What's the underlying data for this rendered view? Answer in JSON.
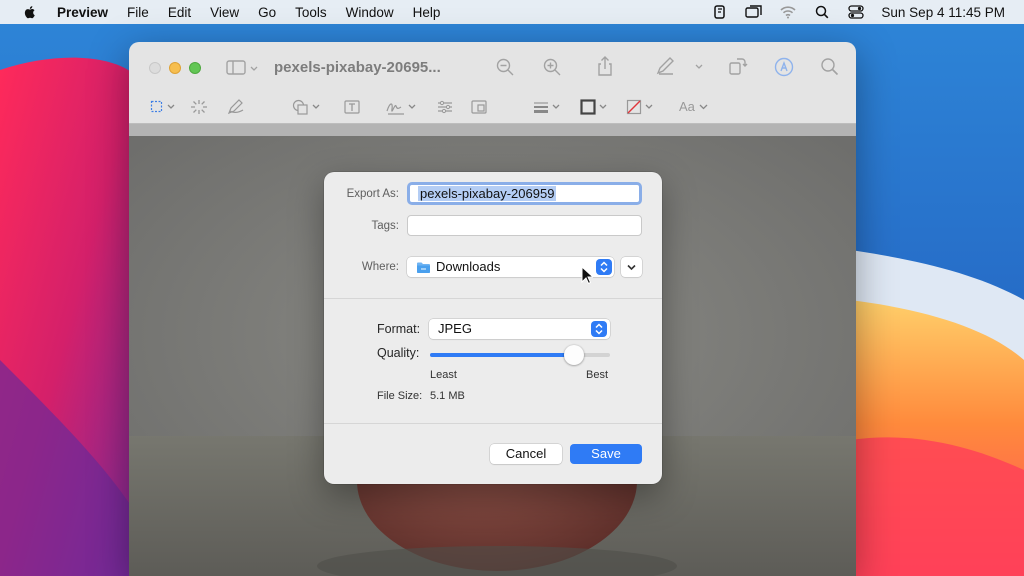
{
  "menubar": {
    "apple_icon": "apple-logo-icon",
    "app_name": "Preview",
    "items": [
      "File",
      "Edit",
      "View",
      "Go",
      "Tools",
      "Window",
      "Help"
    ],
    "status_icons": [
      "notes-icon",
      "screen-mirroring-icon",
      "wifi-icon",
      "search-icon",
      "control-center-icon"
    ],
    "clock": "Sun Sep 4  11:45 PM"
  },
  "window": {
    "title": "pexels-pixabay-20695...",
    "toolbar_icons": [
      "sidebar-icon",
      "zoom-out-icon",
      "zoom-in-icon",
      "share-icon",
      "markup-icon",
      "rotate-icon",
      "annotate-icon",
      "search-icon"
    ],
    "markup_tools": [
      "rectangle-selection-icon",
      "instant-alpha-icon",
      "sketch-icon",
      "shapes-icon",
      "text-box-icon",
      "signature-icon",
      "adjust-color-icon",
      "adjust-size-icon",
      "line-style-icon",
      "border-color-icon",
      "fill-color-icon",
      "text-style-icon"
    ],
    "text_style_label": "Aa"
  },
  "export_sheet": {
    "export_as_label": "Export As:",
    "export_as_value": "pexels-pixabay-206959",
    "tags_label": "Tags:",
    "tags_value": "",
    "where_label": "Where:",
    "where_value": "Downloads",
    "format_label": "Format:",
    "format_value": "JPEG",
    "quality_label": "Quality:",
    "quality_level": 0.8,
    "quality_min_label": "Least",
    "quality_max_label": "Best",
    "file_size_label": "File Size:",
    "file_size_value": "5.1 MB",
    "cancel_label": "Cancel",
    "save_label": "Save"
  },
  "colors": {
    "accent": "#2f7bf5",
    "sheet_bg": "#ececec"
  }
}
